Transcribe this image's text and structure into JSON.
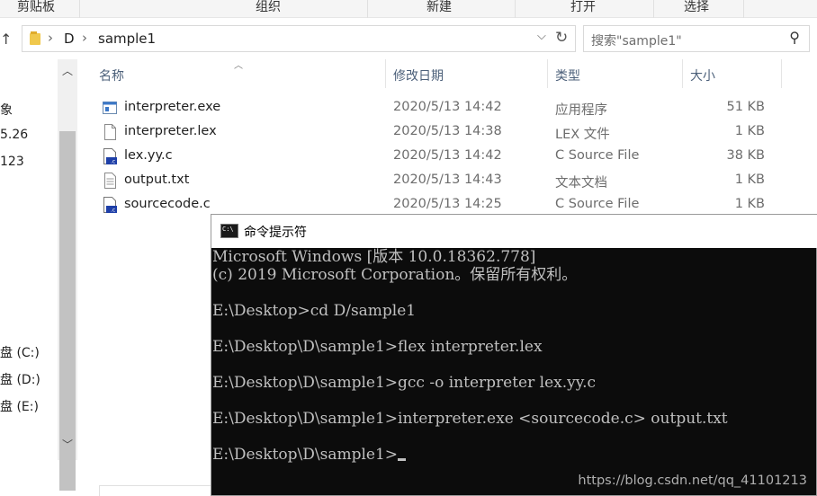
{
  "ribbon": {
    "groups": [
      "剪贴板",
      "组织",
      "新建",
      "打开",
      "选择"
    ]
  },
  "address": {
    "crumbs": [
      "D",
      "sample1"
    ],
    "search_placeholder": "搜索\"sample1\""
  },
  "nav": {
    "items": [
      "象",
      "5.26",
      "123",
      "盘 (C:)",
      "盘 (D:)",
      "盘 (E:)"
    ]
  },
  "list": {
    "headers": {
      "name": "名称",
      "date": "修改日期",
      "type": "类型",
      "size": "大小"
    },
    "files": [
      {
        "name": "interpreter.exe",
        "date": "2020/5/13 14:42",
        "type": "应用程序",
        "size": "51 KB",
        "icon": "exe-icon"
      },
      {
        "name": "interpreter.lex",
        "date": "2020/5/13 14:38",
        "type": "LEX 文件",
        "size": "1 KB",
        "icon": "file-icon"
      },
      {
        "name": "lex.yy.c",
        "date": "2020/5/13 14:42",
        "type": "C Source File",
        "size": "38 KB",
        "icon": "c-file-icon"
      },
      {
        "name": "output.txt",
        "date": "2020/5/13 14:43",
        "type": "文本文档",
        "size": "1 KB",
        "icon": "txt-icon"
      },
      {
        "name": "sourcecode.c",
        "date": "2020/5/13 14:25",
        "type": "C Source File",
        "size": "1 KB",
        "icon": "c-file-icon"
      }
    ]
  },
  "cmd": {
    "title": "命令提示符",
    "lines": [
      "Microsoft Windows [版本 10.0.18362.778]",
      "(c) 2019 Microsoft Corporation。保留所有权利。",
      "",
      "E:\\Desktop>cd D/sample1",
      "",
      "E:\\Desktop\\D\\sample1>flex interpreter.lex",
      "",
      "E:\\Desktop\\D\\sample1>gcc -o interpreter lex.yy.c",
      "",
      "E:\\Desktop\\D\\sample1>interpreter.exe <sourcecode.c> output.txt",
      "",
      "E:\\Desktop\\D\\sample1>"
    ]
  },
  "watermark": "https://blog.csdn.net/qq_41101213"
}
